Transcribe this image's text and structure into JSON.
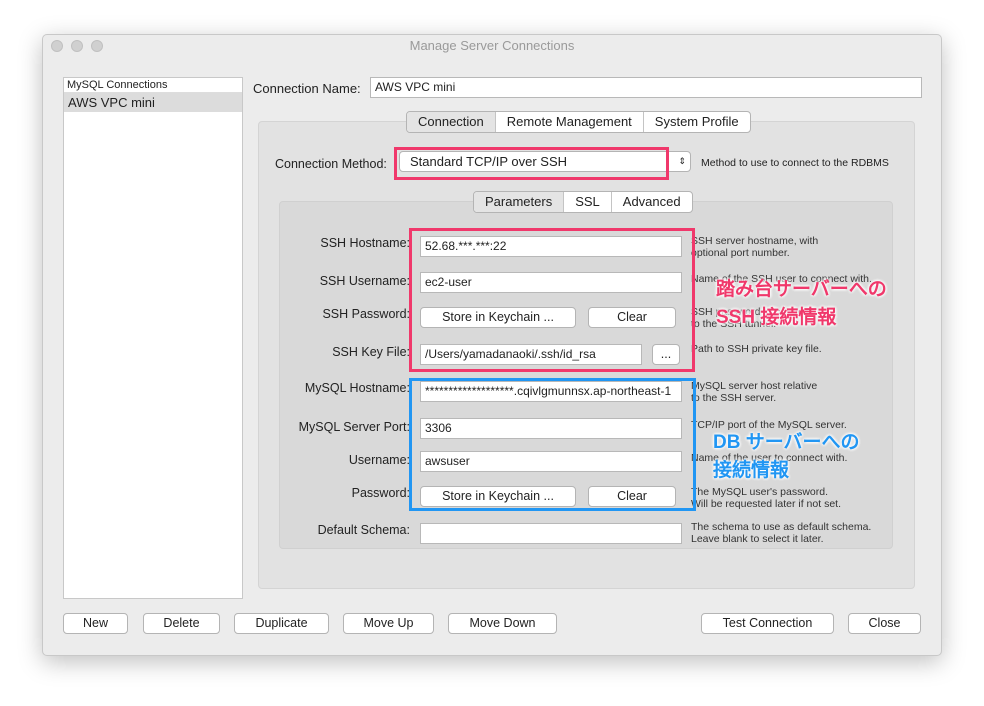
{
  "window": {
    "title": "Manage Server Connections"
  },
  "sidebar": {
    "header": "MySQL Connections",
    "items": [
      "AWS VPC mini"
    ]
  },
  "connection_name": {
    "label": "Connection Name:",
    "value": "AWS VPC mini"
  },
  "main_tabs": [
    "Connection",
    "Remote Management",
    "System Profile"
  ],
  "method": {
    "label": "Connection Method:",
    "value": "Standard TCP/IP over SSH",
    "desc": "Method to use to connect to the RDBMS"
  },
  "sub_tabs": [
    "Parameters",
    "SSL",
    "Advanced"
  ],
  "fields": {
    "ssh_host": {
      "label": "SSH Hostname:",
      "value": "52.68.***.***:22",
      "desc1": "SSH server hostname, with",
      "desc2": "optional port number."
    },
    "ssh_user": {
      "label": "SSH Username:",
      "value": "ec2-user",
      "desc1": "Name of the SSH user to connect with."
    },
    "ssh_pass": {
      "label": "SSH Password:",
      "store": "Store in Keychain ...",
      "clear": "Clear",
      "desc1": "SSH password to connect",
      "desc2": "to the SSH tunnel."
    },
    "ssh_key": {
      "label": "SSH Key File:",
      "value": "/Users/yamadanaoki/.ssh/id_rsa",
      "browse": "...",
      "desc1": "Path to SSH private key file."
    },
    "mysql_host": {
      "label": "MySQL Hostname:",
      "value": "*******************.cqivlgmunnsx.ap-northeast-1",
      "desc1": "MySQL server host relative",
      "desc2": "to the SSH server."
    },
    "mysql_port": {
      "label": "MySQL Server Port:",
      "value": "3306",
      "desc1": "TCP/IP port of the MySQL server."
    },
    "username": {
      "label": "Username:",
      "value": "awsuser",
      "desc1": "Name of the user to connect with."
    },
    "password": {
      "label": "Password:",
      "store": "Store in Keychain ...",
      "clear": "Clear",
      "desc1": "The MySQL user's password.",
      "desc2": "Will be requested later if not set."
    },
    "schema": {
      "label": "Default Schema:",
      "value": "",
      "desc1": "The schema to use as default schema.",
      "desc2": "Leave blank to select it later."
    }
  },
  "annotations": {
    "ssh1": "踏み台サーバーへの",
    "ssh2": "SSH 接続情報",
    "db1": "DB サーバーへの",
    "db2": "接続情報"
  },
  "buttons": {
    "new": "New",
    "delete": "Delete",
    "duplicate": "Duplicate",
    "move_up": "Move Up",
    "move_down": "Move Down",
    "test": "Test Connection",
    "close": "Close"
  },
  "colors": {
    "pink": "#f0386b",
    "blue": "#2196f3"
  }
}
